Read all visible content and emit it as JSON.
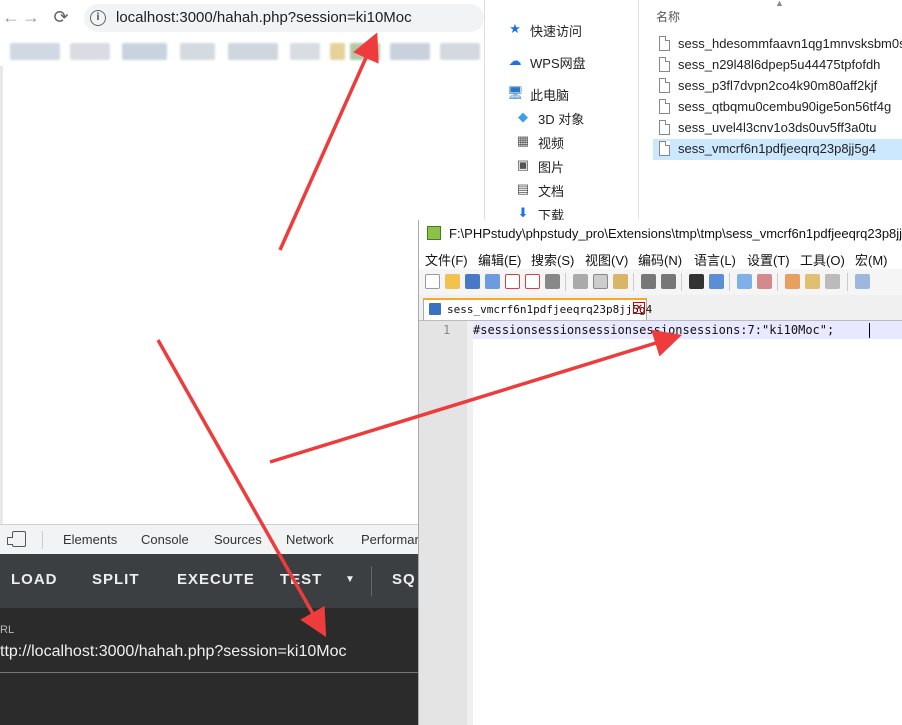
{
  "browser": {
    "address": "localhost:3000/hahah.php?session=ki10Moc",
    "back_icon": "back-arrow-icon",
    "forward_icon": "forward-arrow-icon",
    "reload_icon": "reload-icon",
    "info_icon": "info-icon"
  },
  "devtools": {
    "tabs": [
      "Elements",
      "Console",
      "Sources",
      "Network",
      "Performar"
    ]
  },
  "hackbar": {
    "buttons": [
      "LOAD",
      "SPLIT",
      "EXECUTE",
      "TEST",
      "SQ"
    ],
    "url_label": "RL",
    "url_value": "ttp://localhost:3000/hahah.php?session=ki10Moc"
  },
  "explorer": {
    "nav": [
      "快速访问",
      "WPS网盘",
      "此电脑",
      "3D 对象",
      "视频",
      "图片",
      "文档",
      "下载"
    ],
    "column_header": "名称",
    "files": [
      "sess_hdesommfaavn1qg1mnvsksbm0s",
      "sess_n29l48l6dpep5u44475tpfofdh",
      "sess_p3fl7dvpn2co4k90m80aff2kjf",
      "sess_qtbqmu0cembu90ige5on56tf4g",
      "sess_uvel4l3cnv1o3ds0uv5ff3a0tu",
      "sess_vmcrf6n1pdfjeeqrq23p8jj5g4"
    ],
    "selected_file_index": 5
  },
  "notepad": {
    "title": "F:\\PHPstudy\\phpstudy_pro\\Extensions\\tmp\\tmp\\sess_vmcrf6n1pdfjeeqrq23p8jj",
    "menu": [
      "文件(F)",
      "编辑(E)",
      "搜索(S)",
      "视图(V)",
      "编码(N)",
      "语言(L)",
      "设置(T)",
      "工具(O)",
      "宏(M)"
    ],
    "tab_label": "sess_vmcrf6n1pdfjeeqrq23p8jj5g4",
    "line_number": "1",
    "code": "#sessionsessionsessionsessionsessions:7:\"ki10Moc\";"
  },
  "annotation_color": "#ee3b3b"
}
